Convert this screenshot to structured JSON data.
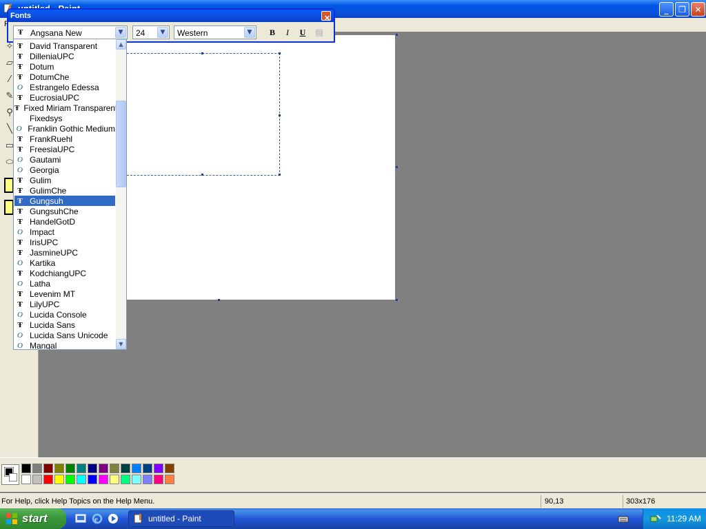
{
  "window": {
    "title": "untitled - Paint",
    "menu_first": "F"
  },
  "fonts_toolbar": {
    "title": "Fonts",
    "font_name": "Angsana New",
    "font_size": "24",
    "script": "Western",
    "bold_label": "B",
    "italic_label": "I",
    "underline_label": "U"
  },
  "font_list": {
    "items": [
      {
        "name": "David Transparent",
        "type": "tt"
      },
      {
        "name": "DilleniaUPC",
        "type": "tt"
      },
      {
        "name": "Dotum",
        "type": "tt"
      },
      {
        "name": "DotumChe",
        "type": "tt"
      },
      {
        "name": "Estrangelo Edessa",
        "type": "ot"
      },
      {
        "name": "EucrosiaUPC",
        "type": "tt"
      },
      {
        "name": "Fixed Miriam Transparent",
        "type": "tt"
      },
      {
        "name": "Fixedsys",
        "type": "none"
      },
      {
        "name": "Franklin Gothic Medium",
        "type": "ot"
      },
      {
        "name": "FrankRuehl",
        "type": "tt"
      },
      {
        "name": "FreesiaUPC",
        "type": "tt"
      },
      {
        "name": "Gautami",
        "type": "ot"
      },
      {
        "name": "Georgia",
        "type": "ot"
      },
      {
        "name": "Gulim",
        "type": "tt"
      },
      {
        "name": "GulimChe",
        "type": "tt"
      },
      {
        "name": "Gungsuh",
        "type": "tt",
        "selected": true
      },
      {
        "name": "GungsuhChe",
        "type": "tt"
      },
      {
        "name": "HandelGotD",
        "type": "tt"
      },
      {
        "name": "Impact",
        "type": "ot"
      },
      {
        "name": "IrisUPC",
        "type": "tt"
      },
      {
        "name": "JasmineUPC",
        "type": "tt"
      },
      {
        "name": "Kartika",
        "type": "ot"
      },
      {
        "name": "KodchiangUPC",
        "type": "tt"
      },
      {
        "name": "Latha",
        "type": "ot"
      },
      {
        "name": "Levenim MT",
        "type": "tt"
      },
      {
        "name": "LilyUPC",
        "type": "tt"
      },
      {
        "name": "Lucida Console",
        "type": "ot"
      },
      {
        "name": "Lucida Sans",
        "type": "tt"
      },
      {
        "name": "Lucida Sans Unicode",
        "type": "ot"
      },
      {
        "name": "Mangal",
        "type": "ot"
      }
    ],
    "scroll_position": 0.25
  },
  "icons": {
    "truetype": "Ŧ",
    "opentype": "O"
  },
  "palette": {
    "foreground": "#000000",
    "background": "#ffffff",
    "row1": [
      "#000000",
      "#808080",
      "#800000",
      "#808000",
      "#008000",
      "#008080",
      "#000080",
      "#800080",
      "#808040",
      "#004040",
      "#0080ff",
      "#004080",
      "#8000ff",
      "#804000"
    ],
    "row2": [
      "#ffffff",
      "#c0c0c0",
      "#ff0000",
      "#ffff00",
      "#00ff00",
      "#00ffff",
      "#0000ff",
      "#ff00ff",
      "#ffff80",
      "#00ff80",
      "#80ffff",
      "#8080ff",
      "#ff0080",
      "#ff8040"
    ]
  },
  "statusbar": {
    "help": "For Help, click Help Topics on the Help Menu.",
    "coords": "90,13",
    "size": "303x176"
  },
  "taskbar": {
    "start_label": "start",
    "task_label": "untitled - Paint",
    "clock": "11:29 AM"
  }
}
